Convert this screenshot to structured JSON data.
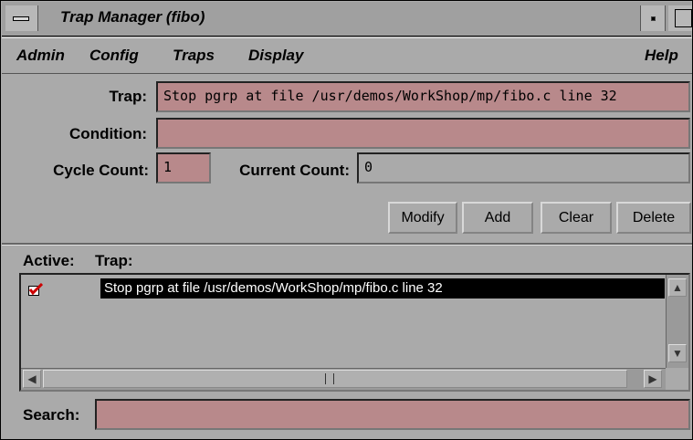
{
  "window": {
    "title": "Trap Manager (fibo)"
  },
  "menubar": {
    "admin": "Admin",
    "config": "Config",
    "traps": "Traps",
    "display": "Display",
    "help": "Help"
  },
  "form": {
    "trap_label": "Trap:",
    "trap_value": "Stop pgrp at file /usr/demos/WorkShop/mp/fibo.c line 32",
    "condition_label": "Condition:",
    "condition_value": "",
    "cycle_label": "Cycle Count:",
    "cycle_value": "1",
    "current_label": "Current Count:",
    "current_value": "0"
  },
  "buttons": {
    "modify": "Modify",
    "add": "Add",
    "clear": "Clear",
    "delete": "Delete"
  },
  "list": {
    "active_header": "Active:",
    "trap_header": "Trap:",
    "rows": [
      {
        "active": true,
        "trap": "Stop pgrp at file /usr/demos/WorkShop/mp/fibo.c line 32"
      }
    ]
  },
  "search": {
    "label": "Search:",
    "value": ""
  },
  "colors": {
    "field": "#b8898b",
    "window": "#aaaaaa",
    "selection": "#000000",
    "check": "#cc0000"
  },
  "icons": [
    "window-menu-icon",
    "minimize-icon",
    "maximize-icon",
    "checkmark-icon",
    "scroll-up-icon",
    "scroll-down-icon",
    "scroll-left-icon",
    "scroll-right-icon"
  ]
}
